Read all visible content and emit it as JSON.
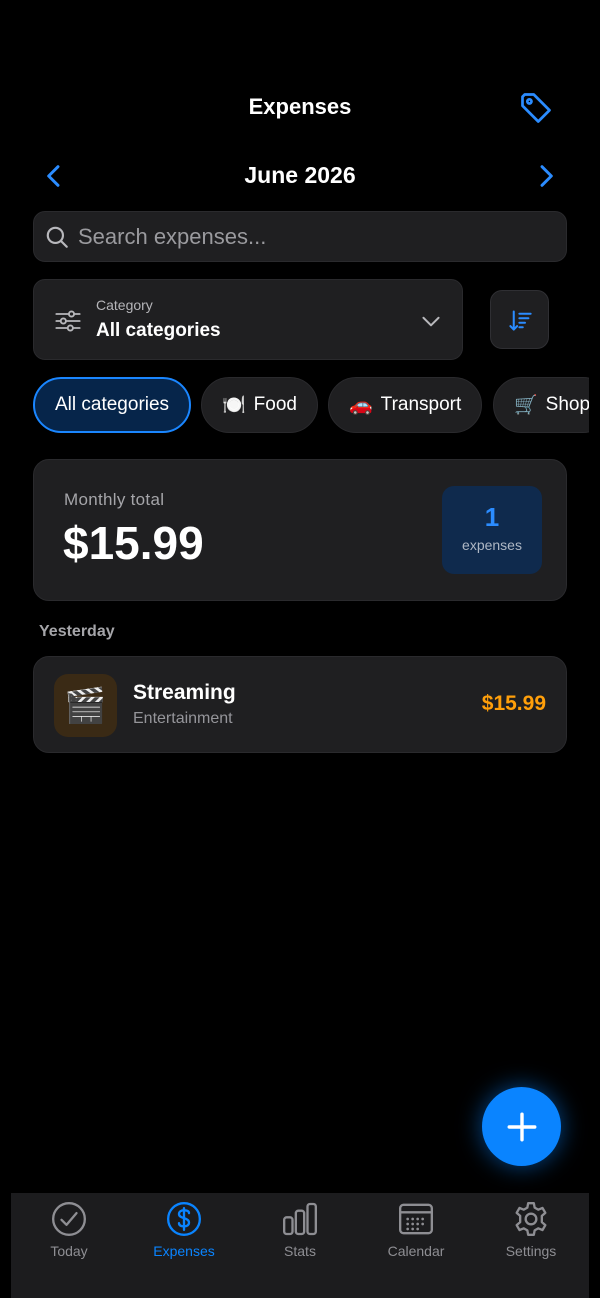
{
  "header": {
    "title": "Expenses"
  },
  "month_nav": {
    "label": "June 2026"
  },
  "search": {
    "placeholder": "Search expenses..."
  },
  "category_filter": {
    "label": "Category",
    "value": "All categories"
  },
  "chips": [
    {
      "label": "All categories",
      "emoji": ""
    },
    {
      "label": "Food",
      "emoji": "🍽️"
    },
    {
      "label": "Transport",
      "emoji": "🚗"
    },
    {
      "label": "Shop",
      "emoji": "🛒"
    }
  ],
  "summary": {
    "label": "Monthly total",
    "amount": "$15.99",
    "count": "1",
    "count_label": "expenses"
  },
  "sections": [
    {
      "label": "Yesterday",
      "items": [
        {
          "name": "Streaming",
          "category": "Entertainment",
          "amount": "$15.99",
          "emoji": "🎬"
        }
      ]
    }
  ],
  "tabs": [
    {
      "label": "Today"
    },
    {
      "label": "Expenses"
    },
    {
      "label": "Stats"
    },
    {
      "label": "Calendar"
    },
    {
      "label": "Settings"
    }
  ],
  "colors": {
    "accent": "#0a84ff",
    "amount": "#ff9f0a",
    "card": "#1f1f21"
  }
}
